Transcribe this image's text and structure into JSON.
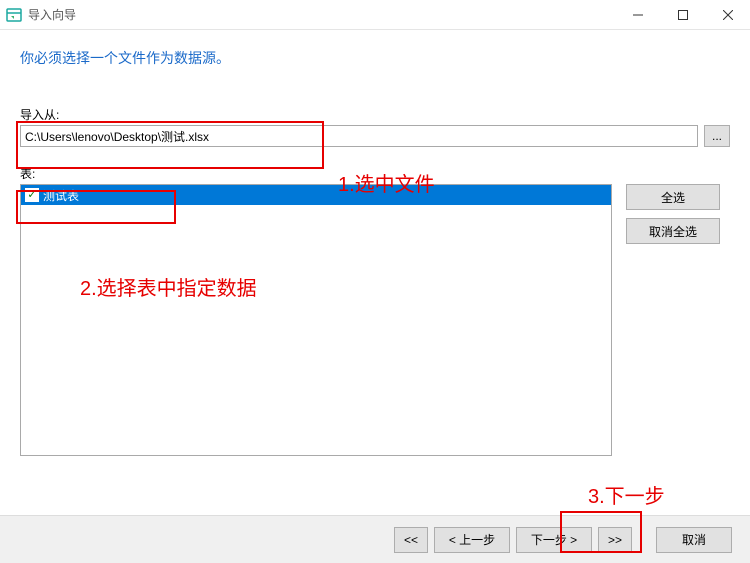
{
  "window": {
    "title": "导入向导"
  },
  "heading": "你必须选择一个文件作为数据源。",
  "import": {
    "label": "导入从:",
    "path": "C:\\Users\\lenovo\\Desktop\\测试.xlsx",
    "browse_label": "..."
  },
  "tables": {
    "label": "表:",
    "items": [
      "测试表"
    ]
  },
  "side_buttons": {
    "select_all": "全选",
    "deselect_all": "取消全选"
  },
  "footer": {
    "first": "<<",
    "prev": "< 上一步",
    "next": "下一步 >",
    "last": ">>",
    "cancel": "取消"
  },
  "annotations": {
    "a1": "1.选中文件",
    "a2": "2.选择表中指定数据",
    "a3": "3.下一步"
  }
}
